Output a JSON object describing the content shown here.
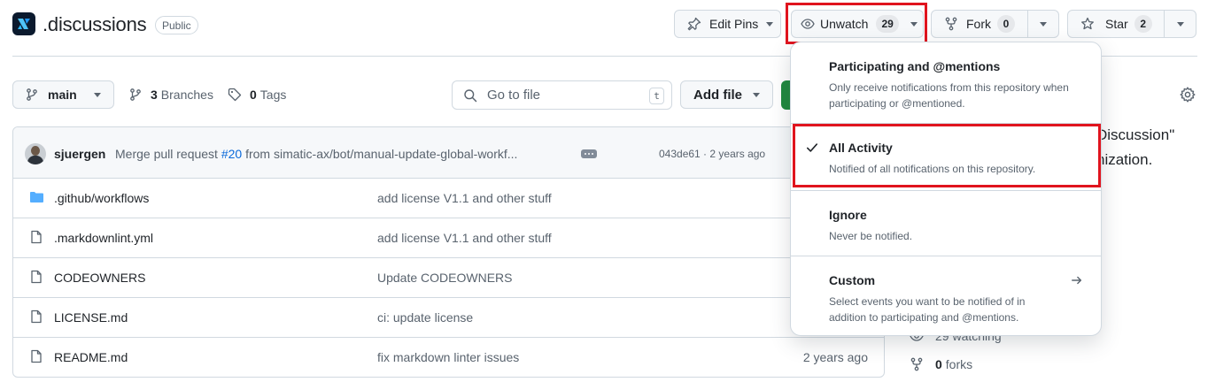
{
  "repo": {
    "name": ".discussions",
    "visibility": "Public"
  },
  "header_actions": {
    "edit_pins": "Edit Pins",
    "unwatch": "Unwatch",
    "watch_count": "29",
    "fork": "Fork",
    "fork_count": "0",
    "star": "Star",
    "star_count": "2"
  },
  "toolbar": {
    "branch": "main",
    "branches_count": "3",
    "branches_label": "Branches",
    "tags_count": "0",
    "tags_label": "Tags",
    "search_placeholder": "Go to file",
    "search_shortcut": "t",
    "add_file": "Add file"
  },
  "latest_commit": {
    "author": "sjuergen",
    "message_prefix": "Merge pull request ",
    "pr_link": "#20",
    "message_suffix": " from simatic-ax/bot/manual-update-global-workf...",
    "meta": "043de61 · 2 years ago"
  },
  "files": [
    {
      "type": "folder",
      "name": ".github/workflows",
      "message": "add license V1.1 and other stuff",
      "age": ""
    },
    {
      "type": "file",
      "name": ".markdownlint.yml",
      "message": "add license V1.1 and other stuff",
      "age": ""
    },
    {
      "type": "file",
      "name": "CODEOWNERS",
      "message": "Update CODEOWNERS",
      "age": ""
    },
    {
      "type": "file",
      "name": "LICENSE.md",
      "message": "ci: update license",
      "age": ""
    },
    {
      "type": "file",
      "name": "README.md",
      "message": "fix markdown linter issues",
      "age": "2 years ago"
    }
  ],
  "sidebar": {
    "about_line1": "Discussion\"",
    "about_line2": "nization.",
    "watching": "29 watching",
    "forks_count": "0",
    "forks_label": "forks"
  },
  "watch_menu": {
    "items": [
      {
        "title": "Participating and @mentions",
        "desc": "Only receive notifications from this repository when participating or @mentioned."
      },
      {
        "title": "All Activity",
        "desc": "Notified of all notifications on this repository."
      },
      {
        "title": "Ignore",
        "desc": "Never be notified."
      },
      {
        "title": "Custom",
        "desc": "Select events you want to be notified of in addition to participating and @mentions."
      }
    ],
    "selected": "All Activity"
  },
  "colors": {
    "highlight": "#e0141e",
    "link": "#0969da",
    "green": "#1f883d",
    "folder": "#54aeff"
  }
}
